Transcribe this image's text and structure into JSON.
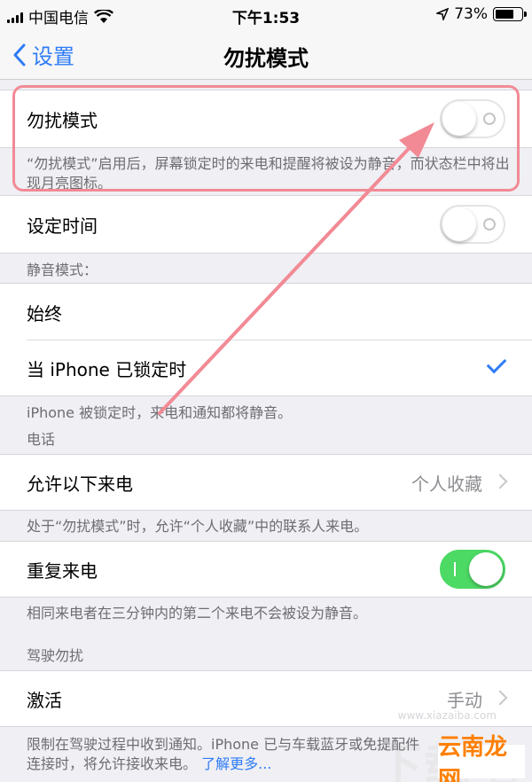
{
  "status_bar": {
    "carrier": "中国电信",
    "time": "下午1:53",
    "battery_percent": "73%",
    "battery_level": 0.73,
    "signal_icon": "signal-bars-icon",
    "wifi_icon": "wifi-icon",
    "location_icon": "location-arrow-icon"
  },
  "nav": {
    "back_label": "设置",
    "title": "勿扰模式"
  },
  "dnd": {
    "label": "勿扰模式",
    "enabled": false,
    "description": "“勿扰模式”启用后，屏幕锁定时的来电和提醒将被设为静音，而状态栏中将出现月亮图标。"
  },
  "scheduled": {
    "label": "设定时间",
    "enabled": false
  },
  "silence": {
    "header": "静音模式：",
    "option_always": "始终",
    "option_locked": "当 iPhone 已锁定时",
    "selected": "当 iPhone 已锁定时",
    "footer": "iPhone 被锁定时，来电和通知都将静音。"
  },
  "phone": {
    "header": "电话",
    "allow_calls_label": "允许以下来电",
    "allow_calls_value": "个人收藏",
    "allow_calls_footer": "处于“勿扰模式”时，允许“个人收藏”中的联系人来电。",
    "repeated_label": "重复来电",
    "repeated_enabled": true,
    "repeated_footer": "相同来电者在三分钟内的第二个来电不会被设为静音。"
  },
  "driving": {
    "header": "驾驶勿扰",
    "activate_label": "激活",
    "activate_value": "手动",
    "footer_text": "限制在驾驶过程中收到通知。iPhone 已与车载蓝牙或免提配件连接时，将允许接收来电。",
    "learn_more": "了解更多..."
  },
  "watermark": {
    "text": "下载吧",
    "url": "www.xiazaiba.com",
    "logo": "云南龙网"
  },
  "colors": {
    "accent": "#2f7cf6",
    "toggle_on": "#4cd964",
    "annotation": "#f28a95",
    "group_background": "#efeff4"
  }
}
